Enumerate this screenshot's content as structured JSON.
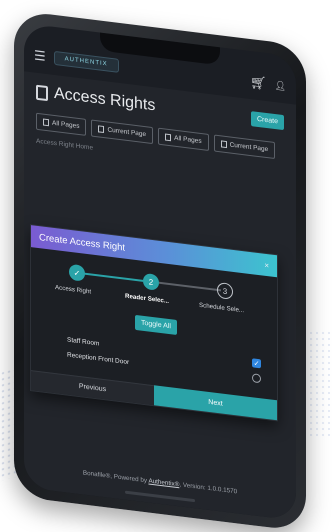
{
  "header": {
    "logo_text": "AUTHENTIX",
    "icons": [
      "menu-icon",
      "cart-icon",
      "user-icon"
    ]
  },
  "page": {
    "title": "Access Rights",
    "create_label": "Create",
    "tabs": [
      {
        "label": "All Pages"
      },
      {
        "label": "Current Page"
      },
      {
        "label": "All Pages"
      },
      {
        "label": "Current Page"
      }
    ],
    "breadcrumb": "Access Right Home"
  },
  "modal": {
    "title": "Create Access Right",
    "close": "×",
    "steps": [
      {
        "label": "Access Right",
        "marker": "✓",
        "state": "done"
      },
      {
        "label": "Reader Selec...",
        "marker": "2",
        "state": "active"
      },
      {
        "label": "Schedule Sele...",
        "marker": "3",
        "state": "todo"
      }
    ],
    "toggle_all": "Toggle All",
    "items": [
      {
        "label": "Staff Room",
        "checked": true
      },
      {
        "label": "Reception Front Door",
        "checked": false
      }
    ],
    "previous": "Previous",
    "next": "Next"
  },
  "footer": {
    "prefix": "Bonafile®, Powered by ",
    "link": "Authentix®",
    "suffix": ", Version: 1.0.0.1570"
  },
  "colors": {
    "accent": "#2aa3a8",
    "header_gradient_start": "#7a5bd1",
    "header_gradient_end": "#3cc4cf",
    "checkbox": "#2f86e0",
    "screen_bg": "#22252b"
  }
}
